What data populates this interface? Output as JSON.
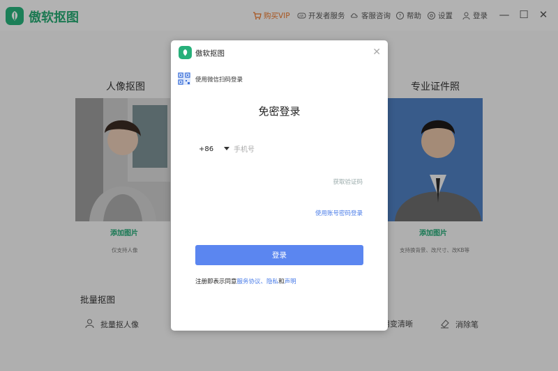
{
  "app": {
    "title": "傲软抠图"
  },
  "topbar": {
    "buy_vip": "购买VIP",
    "developer": "开发者服务",
    "support": "客服咨询",
    "help": "帮助",
    "settings": "设置",
    "login": "登录"
  },
  "window_controls": {
    "minimize": "—",
    "maximize": "☐",
    "close": "✕"
  },
  "main": {
    "portrait": {
      "title": "人像抠图",
      "add_label": "添加图片",
      "note": "仅支持人像"
    },
    "id_photo": {
      "title": "专业证件照",
      "add_label": "添加图片",
      "note": "支持换背景、改尺寸、改KB等"
    },
    "batch": {
      "title": "批量抠图",
      "items": [
        {
          "label": "批量抠人像",
          "icon": "person-icon"
        },
        {
          "label": "用变清晰",
          "icon": "image-icon"
        },
        {
          "label": "消除笔",
          "icon": "eraser-icon"
        }
      ]
    }
  },
  "modal": {
    "title": "傲软抠图",
    "qr_label": "使用微信扫码登录",
    "heading": "免密登录",
    "country_code": "+86",
    "phone_placeholder": "手机号",
    "get_code": "获取验证码",
    "password_login": "使用账号密码登录",
    "login_button": "登录",
    "agreement_prefix": "注册即表示同意",
    "service_agreement": "服务协议",
    "separator": "、",
    "privacy": "隐私",
    "and": "和",
    "statement": "声明"
  },
  "colors": {
    "brand_green": "#27b07a",
    "primary_blue": "#5b86f0",
    "link_blue": "#4a7ce8",
    "vip_orange": "#e8752a"
  }
}
